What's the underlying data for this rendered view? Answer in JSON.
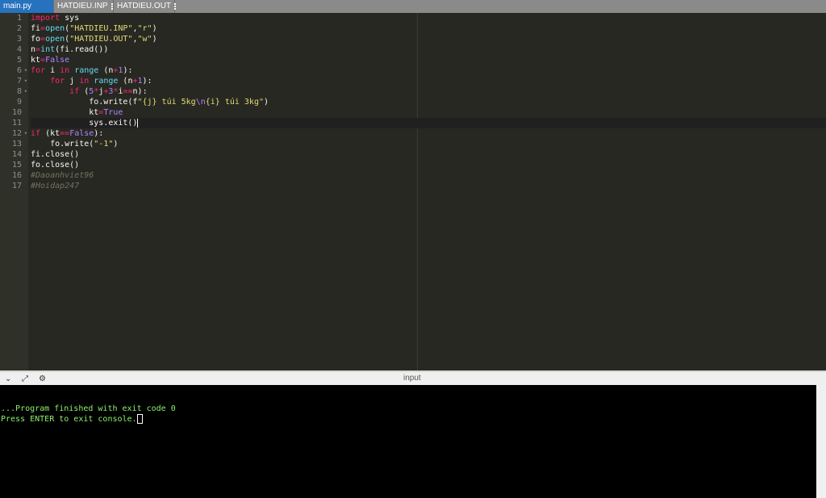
{
  "tabs": [
    {
      "label": "main.py",
      "active": true
    },
    {
      "label": "HATDIEU.INP",
      "active": false
    },
    {
      "label": "HATDIEU.OUT",
      "active": false
    }
  ],
  "editor": {
    "line_numbers": [
      "1",
      "2",
      "3",
      "4",
      "5",
      "6",
      "7",
      "8",
      "9",
      "10",
      "11",
      "12",
      "13",
      "14",
      "15",
      "16",
      "17"
    ],
    "active_line": 11
  },
  "console": {
    "title": "input",
    "lines": [
      "",
      "",
      "...Program finished with exit code 0",
      "Press ENTER to exit console."
    ]
  },
  "colors": {
    "accent": "#2672be",
    "console_text": "#8df26b"
  }
}
